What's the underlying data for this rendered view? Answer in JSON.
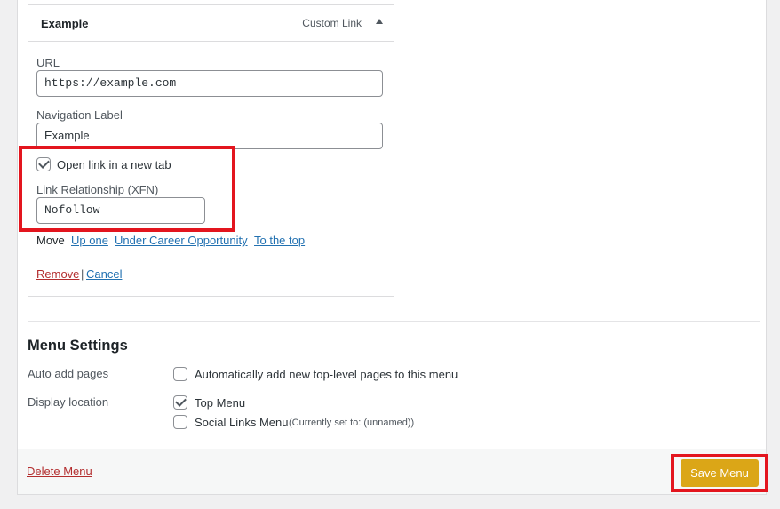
{
  "menu_item": {
    "title": "Example",
    "type": "Custom Link",
    "url_label": "URL",
    "url_value": "https://example.com",
    "nav_label_label": "Navigation Label",
    "nav_label_value": "Example",
    "new_tab_label": "Open link in a new tab",
    "new_tab_checked": true,
    "xfn_label": "Link Relationship (XFN)",
    "xfn_value": "Nofollow",
    "move_label": "Move",
    "move_up": "Up one",
    "move_under": "Under Career Opportunity",
    "move_top": "To the top",
    "remove": "Remove",
    "separator": "|",
    "cancel": "Cancel"
  },
  "menu_settings": {
    "heading": "Menu Settings",
    "auto_add_label": "Auto add pages",
    "auto_add_option": "Automatically add new top-level pages to this menu",
    "auto_add_checked": false,
    "display_location_label": "Display location",
    "locations": [
      {
        "name": "Top Menu",
        "note": "",
        "checked": true
      },
      {
        "name": "Social Links Menu",
        "note": "(Currently set to: (unnamed))",
        "checked": false
      }
    ]
  },
  "footer": {
    "delete": "Delete Menu",
    "save": "Save Menu"
  },
  "colors": {
    "highlight": "#e3151e",
    "save_button": "#dba617",
    "link": "#2271b1",
    "danger_link": "#b32d2e"
  }
}
